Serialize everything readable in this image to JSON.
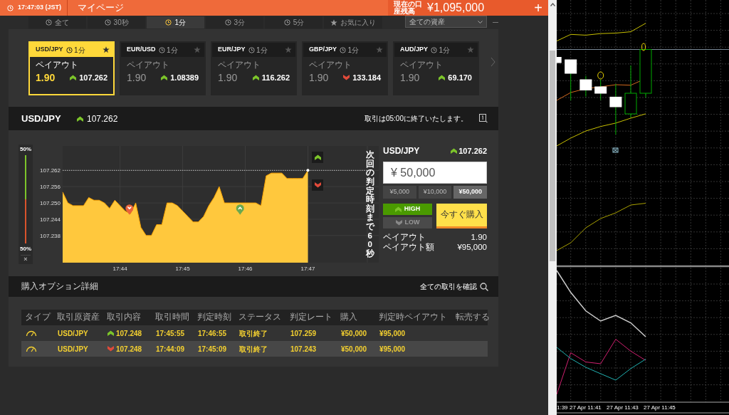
{
  "header": {
    "clock": "17:47:03 (JST)",
    "mypage": "マイページ",
    "balance_label": "現在の口座残高",
    "balance": "¥1,095,000",
    "add": "+"
  },
  "filter_tabs": [
    {
      "label": "全て",
      "selected": false
    },
    {
      "label": "30秒",
      "selected": false
    },
    {
      "label": "1分",
      "selected": true
    },
    {
      "label": "3分",
      "selected": false
    },
    {
      "label": "5分",
      "selected": false
    },
    {
      "label": "お気に入り",
      "selected": false
    }
  ],
  "asset_filter": {
    "value": "全ての資産"
  },
  "asset_cards": [
    {
      "pair": "USD/JPY",
      "duration": "1分",
      "payout_label": "ペイアウト",
      "payout": "1.90",
      "up": true,
      "rate": "107.262",
      "selected": true
    },
    {
      "pair": "EUR/USD",
      "duration": "1分",
      "payout_label": "ペイアウト",
      "payout": "1.90",
      "up": true,
      "rate": "1.08389",
      "selected": false
    },
    {
      "pair": "EUR/JPY",
      "duration": "1分",
      "payout_label": "ペイアウト",
      "payout": "1.90",
      "up": true,
      "rate": "116.262",
      "selected": false
    },
    {
      "pair": "GBP/JPY",
      "duration": "1分",
      "payout_label": "ペイアウト",
      "payout": "1.90",
      "up": false,
      "rate": "133.184",
      "selected": false
    },
    {
      "pair": "AUD/JPY",
      "duration": "1分",
      "payout_label": "ペイアウト",
      "payout": "1.90",
      "up": true,
      "rate": "69.170",
      "selected": false
    }
  ],
  "asset_header": {
    "pair": "USD/JPY",
    "up": true,
    "rate": "107.262",
    "notice": "取引は05:00に終了いたします。"
  },
  "sentiment": {
    "high": "50%",
    "low": "50%",
    "level": 0.5,
    "close": "×"
  },
  "chart": {
    "countdown": "次回の判定時刻まで60秒",
    "chart_data": {
      "type": "area",
      "categories": [
        null,
        null,
        null,
        null,
        null,
        null,
        null,
        null,
        null,
        null,
        null,
        "17:44",
        null,
        null,
        null,
        null,
        null,
        null,
        null,
        null,
        null,
        null,
        null,
        "17:45",
        null,
        null,
        null,
        null,
        null,
        null,
        null,
        null,
        null,
        null,
        null,
        "17:46",
        null,
        null,
        null,
        null,
        null,
        null,
        null,
        null,
        null,
        null,
        null,
        "17:47"
      ],
      "values": [
        107.254,
        107.25,
        107.249,
        107.249,
        107.249,
        107.252,
        107.251,
        107.251,
        107.25,
        107.248,
        107.251,
        107.249,
        107.247,
        107.246,
        107.25,
        107.241,
        107.238,
        107.238,
        107.242,
        107.242,
        107.25,
        107.25,
        107.249,
        107.247,
        107.245,
        107.243,
        107.243,
        107.245,
        107.249,
        107.252,
        107.256,
        107.25,
        107.25,
        107.25,
        107.25,
        107.25,
        107.25,
        107.25,
        107.249,
        107.26,
        107.261,
        107.261,
        107.261,
        107.259,
        107.259,
        107.259,
        107.259,
        107.262
      ],
      "ylim": [
        107.228,
        107.271
      ],
      "grid": true,
      "ref_lines": [
        {
          "axis": "y",
          "value": 107.262
        }
      ],
      "yticks": [
        {
          "value": 107.238,
          "label": "107.238"
        },
        {
          "value": 107.244,
          "label": "107.244"
        },
        {
          "value": 107.25,
          "label": "107.250"
        },
        {
          "value": 107.256,
          "label": "107.256"
        },
        {
          "value": 107.262,
          "label": "107.262"
        }
      ]
    }
  },
  "order": {
    "pair": "USD/JPY",
    "up": true,
    "rate": "107.262",
    "amount": "¥ 50,000",
    "presets": [
      {
        "label": "¥5,000",
        "selected": false
      },
      {
        "label": "¥10,000",
        "selected": false
      },
      {
        "label": "¥50,000",
        "selected": true
      }
    ],
    "high": {
      "label": "HIGH",
      "selected": true
    },
    "low": {
      "label": "LOW",
      "selected": false
    },
    "buy": "今すぐ購入",
    "payout_label": "ペイアウト",
    "payout": "1.90",
    "payout_amount_label": "ペイアウト額",
    "payout_amount": "¥95,000"
  },
  "details": {
    "title": "購入オプション詳細",
    "link": "全ての取引を確認",
    "columns": [
      "タイプ",
      "取引原資産",
      "取引内容",
      "取引時間",
      "判定時刻",
      "ステータス",
      "判定レート",
      "購入",
      "判定時ペイアウト",
      "転売する"
    ],
    "rows": [
      {
        "asset": "USD/JPY",
        "up": true,
        "rate": "107.248",
        "time": "17:45:55",
        "expiry": "17:46:55",
        "status": "取引終了",
        "close_rate": "107.259",
        "purchase": "¥50,000",
        "payout": "¥95,000",
        "selected": false
      },
      {
        "asset": "USD/JPY",
        "up": false,
        "rate": "107.248",
        "time": "17:44:09",
        "expiry": "17:45:09",
        "status": "取引終了",
        "close_rate": "107.243",
        "purchase": "¥50,000",
        "payout": "¥95,000",
        "selected": true
      }
    ]
  },
  "mt4": {
    "time_labels": [
      "1:39",
      "27 Apr 11:41",
      "27 Apr 11:43",
      "27 Apr 11:45"
    ]
  }
}
